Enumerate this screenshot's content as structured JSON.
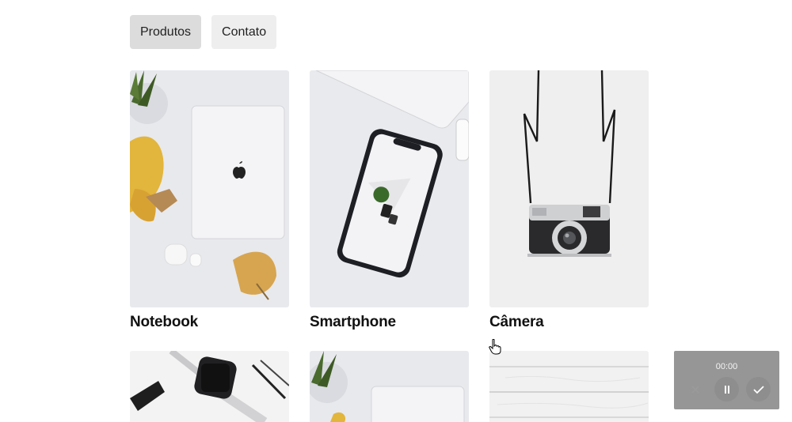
{
  "nav": {
    "items": [
      {
        "label": "Produtos",
        "active": true
      },
      {
        "label": "Contato",
        "active": false
      }
    ]
  },
  "products": [
    {
      "title": "Notebook",
      "image": "laptop-photo"
    },
    {
      "title": "Smartphone",
      "image": "smartphone-photo"
    },
    {
      "title": "Câmera",
      "image": "camera-photo"
    },
    {
      "image": "smartwatch-photo"
    },
    {
      "image": "laptop-photo"
    },
    {
      "image": "white-wood-photo"
    }
  ],
  "recorder": {
    "time": "00:00",
    "buttons": [
      "close-icon",
      "pause-icon",
      "check-icon"
    ]
  },
  "colors": {
    "nav_active": "#dcdcdc",
    "nav_inactive": "#eeeeee",
    "recorder_bg": "#787878"
  }
}
